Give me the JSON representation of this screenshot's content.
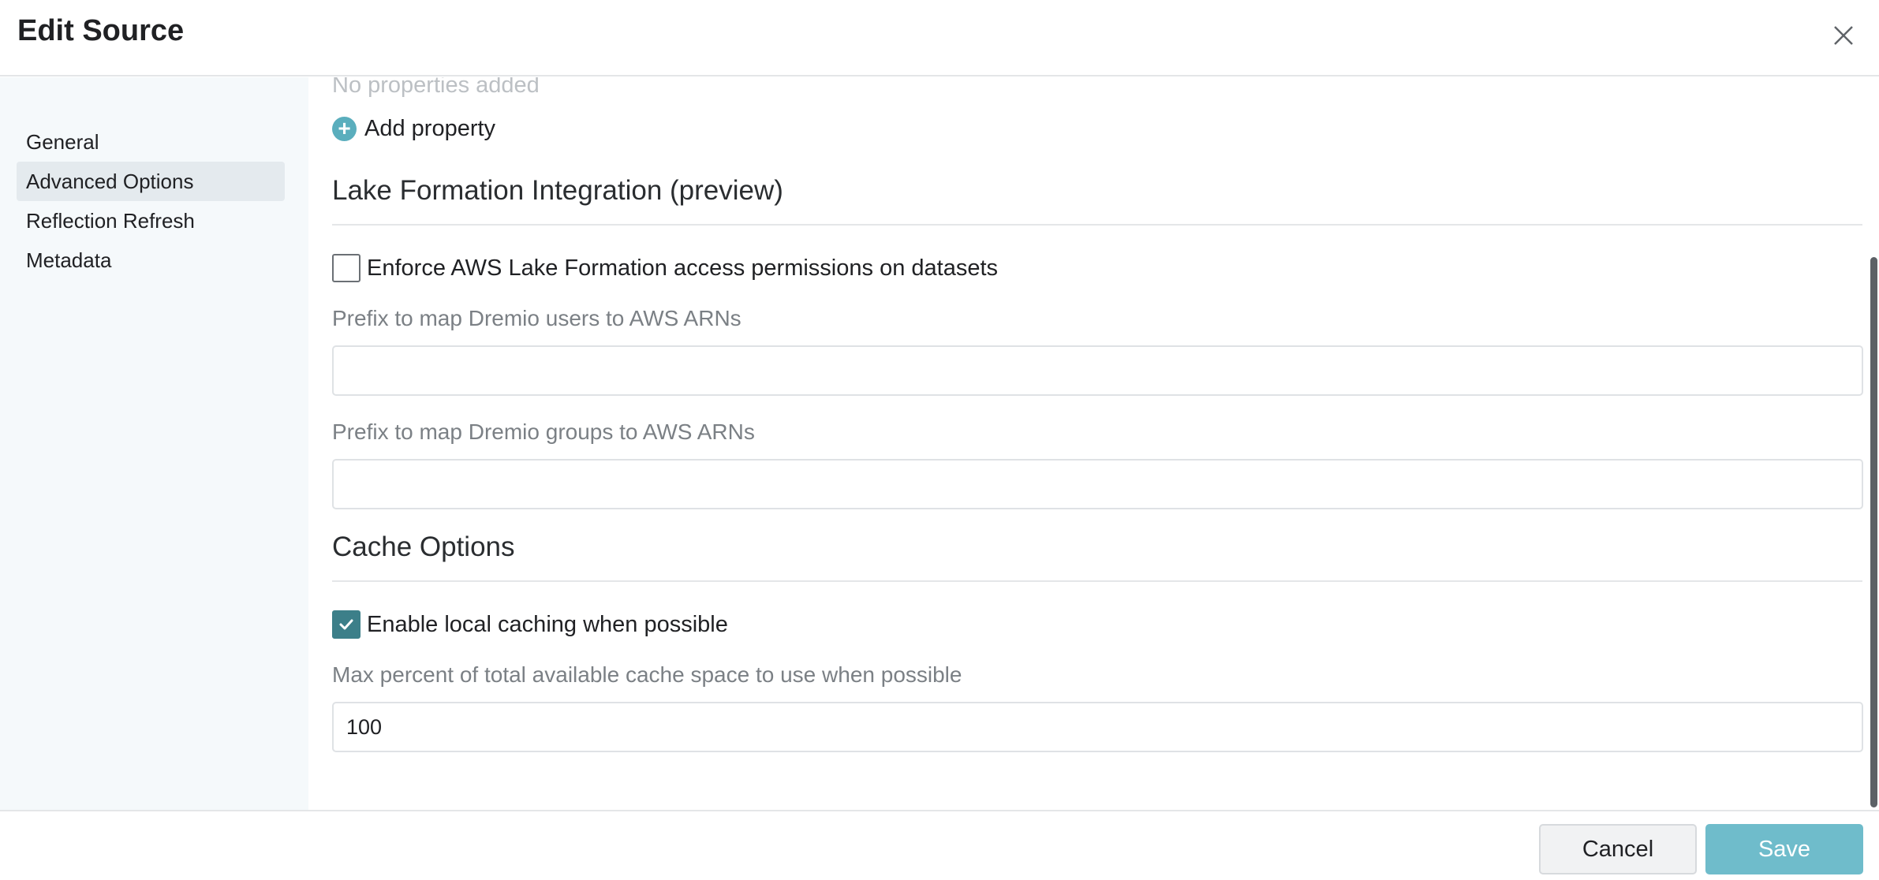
{
  "dialog": {
    "title": "Edit Source"
  },
  "sidebar": {
    "items": [
      {
        "label": "General",
        "active": false
      },
      {
        "label": "Advanced Options",
        "active": true
      },
      {
        "label": "Reflection Refresh",
        "active": false
      },
      {
        "label": "Metadata",
        "active": false
      }
    ]
  },
  "properties": {
    "empty_text": "No properties added",
    "add_label": "Add property",
    "add_icon": "plus-circle-icon"
  },
  "lake_formation": {
    "title": "Lake Formation Integration (preview)",
    "enforce_label": "Enforce AWS Lake Formation access permissions on datasets",
    "enforce_checked": false,
    "users_prefix_label": "Prefix to map Dremio users to AWS ARNs",
    "users_prefix_value": "",
    "groups_prefix_label": "Prefix to map Dremio groups to AWS ARNs",
    "groups_prefix_value": ""
  },
  "cache": {
    "title": "Cache Options",
    "local_caching_label": "Enable local caching when possible",
    "local_caching_checked": true,
    "max_percent_label": "Max percent of total available cache space to use when possible",
    "max_percent_value": "100"
  },
  "footer": {
    "cancel_label": "Cancel",
    "save_label": "Save"
  },
  "colors": {
    "accent": "#3c7f89",
    "save_button": "#6fbccb",
    "plus_icon": "#5aaebd"
  }
}
